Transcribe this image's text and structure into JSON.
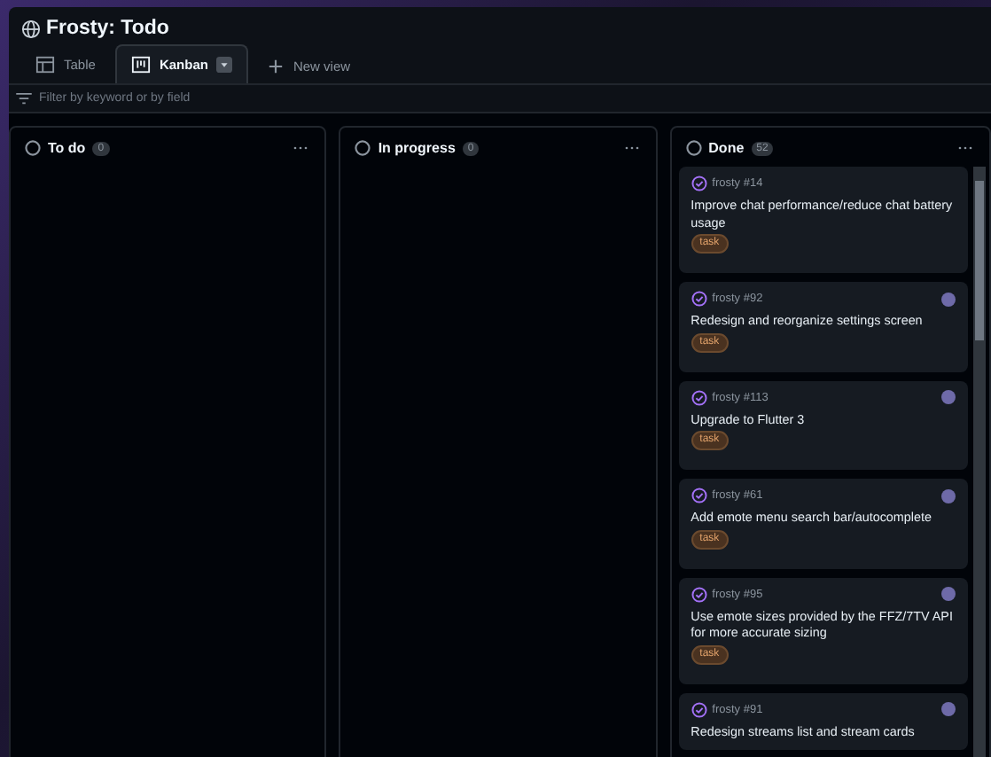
{
  "project": {
    "title": "Frosty: Todo"
  },
  "tabs": [
    {
      "label": "Table",
      "kind": "table",
      "selected": false
    },
    {
      "label": "Kanban",
      "kind": "board",
      "selected": true
    }
  ],
  "new_view": {
    "label": "New view"
  },
  "filter": {
    "placeholder": "Filter by keyword or by field"
  },
  "columns": [
    {
      "name": "To do",
      "count": "0"
    },
    {
      "name": "In progress",
      "count": "0"
    },
    {
      "name": "Done",
      "count": "52",
      "cards": [
        {
          "ref": "frosty #14",
          "title": "Improve chat performance/reduce chat battery usage",
          "tag": "task",
          "avatar": false
        },
        {
          "ref": "frosty #92",
          "title": "Redesign and reorganize settings screen",
          "tag": "task",
          "avatar": true
        },
        {
          "ref": "frosty #113",
          "title": "Upgrade to Flutter 3",
          "tag": "task",
          "avatar": true
        },
        {
          "ref": "frosty #61",
          "title": "Add emote menu search bar/autocomplete",
          "tag": "task",
          "avatar": true
        },
        {
          "ref": "frosty #95",
          "title": "Use emote sizes provided by the FFZ/7TV API for more accurate sizing",
          "tag": "task",
          "avatar": true
        },
        {
          "ref": "frosty #91",
          "title": "Redesign streams list and stream cards",
          "avatar": true
        }
      ]
    }
  ]
}
